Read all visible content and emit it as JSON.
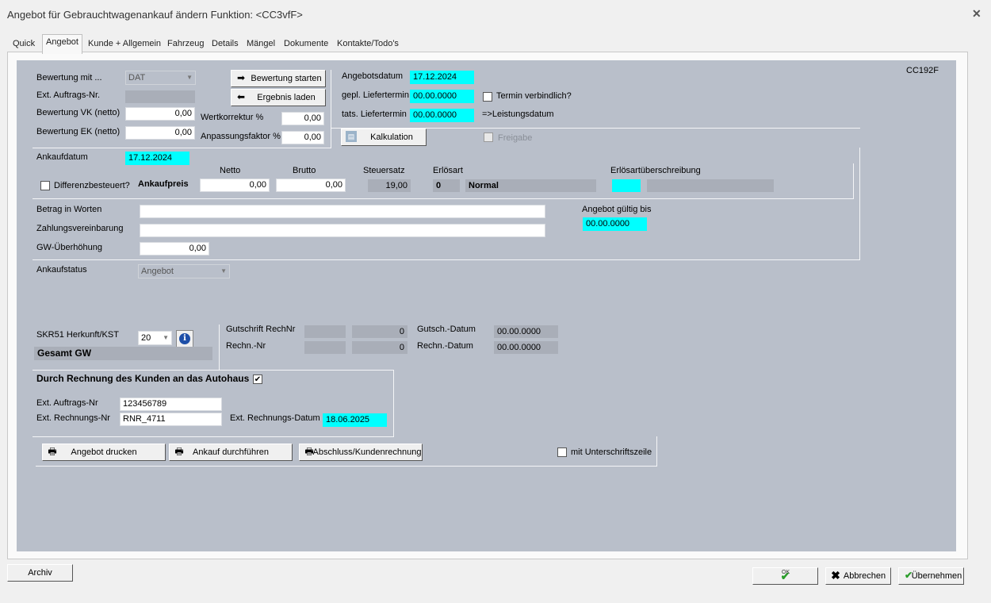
{
  "window": {
    "title": "Angebot für Gebrauchtwagenankauf ändern   Funktion: <CC3vfF>"
  },
  "tabs": [
    "Quick",
    "Angebot",
    "Kunde + Allgemein",
    "Fahrzeug",
    "Details",
    "Mängel",
    "Dokumente",
    "Kontakte/Todo's"
  ],
  "code": "CC192F",
  "bewertung": {
    "mit_label": "Bewertung mit ...",
    "mit_value": "DAT",
    "ext_auftrag_label": "Ext. Auftrags-Nr.",
    "vk_label": "Bewertung VK (netto)",
    "vk_value": "0,00",
    "ek_label": "Bewertung EK (netto)",
    "ek_value": "0,00",
    "start_button": "Bewertung starten",
    "load_button": "Ergebnis laden",
    "wertkorrektur_label": "Wertkorrektur %",
    "wertkorrektur_value": "0,00",
    "anpassung_label": "Anpassungsfaktor %",
    "anpassung_value": "0,00"
  },
  "angebot": {
    "datum_label": "Angebotsdatum",
    "datum_value": "17.12.2024",
    "gepl_label": "gepl. Liefertermin",
    "gepl_value": "00.00.0000",
    "tats_label": "tats. Liefertermin",
    "tats_value": "00.00.0000",
    "termin_label": "Termin verbindlich?",
    "leistung_label": "=>Leistungsdatum",
    "kalkulation_button": "Kalkulation",
    "freigabe_label": "Freigabe"
  },
  "ankauf": {
    "datum_label": "Ankaufdatum",
    "datum_value": "17.12.2024",
    "netto_header": "Netto",
    "brutto_header": "Brutto",
    "steuer_header": "Steuersatz",
    "erloesart_header": "Erlösart",
    "erloes_ueber_header": "Erlösartüberschreibung",
    "diff_label": "Differenzbesteuert?",
    "preis_label": "Ankaufpreis",
    "netto_value": "0,00",
    "brutto_value": "0,00",
    "steuer_value": "19,00",
    "erloesart_code": "0",
    "erloesart_name": "Normal"
  },
  "betrag": {
    "worte_label": "Betrag in Worten",
    "zahlung_label": "Zahlungsvereinbarung",
    "gw_label": "GW-Überhöhung",
    "gw_value": "0,00",
    "gueltig_label": "Angebot gültig bis",
    "gueltig_value": "00.00.0000"
  },
  "status": {
    "label": "Ankaufstatus",
    "value": "Angebot"
  },
  "skr": {
    "label": "SKR51 Herkunft/KST",
    "value": "20",
    "gesamt": "Gesamt GW",
    "gutschrift_label": "Gutschrift RechNr",
    "gutschrift_num": "0",
    "rechn_label": "Rechn.-Nr",
    "rechn_num": "0",
    "gutsch_datum_label": "Gutsch.-Datum",
    "gutsch_datum_value": "00.00.0000",
    "rechn_datum_label": "Rechn.-Datum",
    "rechn_datum_value": "00.00.0000"
  },
  "rechnung": {
    "header": "Durch Rechnung des Kunden an das Autohaus",
    "auftrag_label": "Ext. Auftrags-Nr",
    "auftrag_value": "123456789",
    "rechnung_label": "Ext. Rechnungs-Nr",
    "rechnung_value": "RNR_4711",
    "datum_label": "Ext. Rechnungs-Datum",
    "datum_value": "18.06.2025"
  },
  "actions": {
    "print": "Angebot drucken",
    "ankauf": "Ankauf durchführen",
    "abschluss": "Abschluss/Kundenrechnung",
    "unterschrift": "mit Unterschriftszeile"
  },
  "footer": {
    "archiv": "Archiv",
    "ok": "OK",
    "abbrechen": "Abbrechen",
    "uebernehmen": "Übernehmen"
  }
}
